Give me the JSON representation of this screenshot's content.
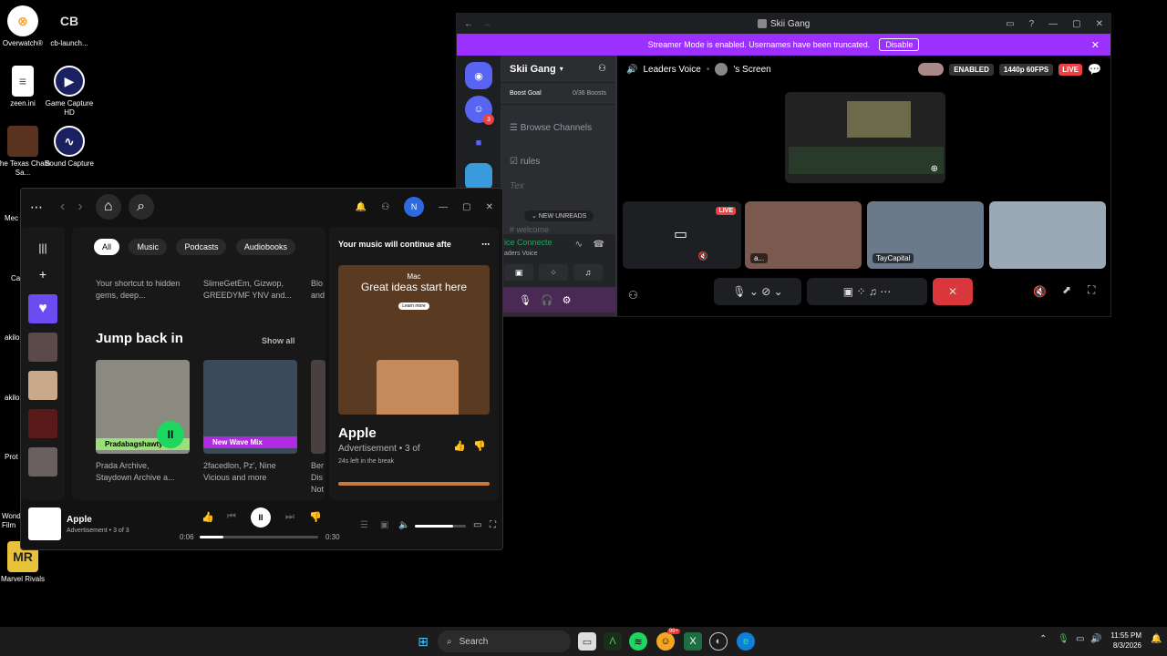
{
  "desktop": {
    "icons": [
      {
        "label": "Overwatch®",
        "glyph": "OW",
        "color": "#f99e1a"
      },
      {
        "label": "cb-launch...",
        "glyph": "CB",
        "color": "#ddd"
      },
      {
        "label": "zeen.ini",
        "glyph": "≡",
        "color": "#fff"
      },
      {
        "label": "Game Capture HD",
        "glyph": "▶",
        "color": "#2b3a8f"
      },
      {
        "label": "The Texas Chain Sa...",
        "glyph": "TX",
        "color": "#6b3a1f"
      },
      {
        "label": "Sound Capture",
        "glyph": "∿",
        "color": "#2b3a8f"
      },
      {
        "label": "Marvel Rivals",
        "glyph": "MR",
        "color": "#e8c23a"
      }
    ],
    "partial_labels": [
      "Mec",
      "Ca",
      "akilo",
      "akilo",
      "Prot",
      "Wond Film"
    ]
  },
  "discord": {
    "window_title": "Skii Gang",
    "banner_text": "Streamer Mode is enabled. Usernames have been truncated.",
    "banner_button": "Disable",
    "server_name": "Skii Gang",
    "boost_goal": "Boost Goal",
    "boost_count": "0/36 Boosts",
    "channels": [
      "Browse Channels",
      "rules"
    ],
    "new_unreads": "NEW UNREADS",
    "voice_connected": "ice Connecte",
    "voice_channel": "aders Voice",
    "header_channel": "Leaders Voice",
    "header_screen": "'s Screen",
    "enabled_badge": "ENABLED",
    "quality_badge": "1440p 60FPS",
    "live_badge": "LIVE",
    "tile_live": "LIVE",
    "tile_user_a": "a...",
    "tile_user_tay": "TayCapital",
    "mention_badge": "3",
    "truncated_text": "Tex",
    "truncated_welcome": "# welcome"
  },
  "spotify": {
    "avatar_letter": "N",
    "chips": [
      "All",
      "Music",
      "Podcasts",
      "Audiobooks"
    ],
    "top_cards": [
      {
        "text": "Your shortcut to hidden gems, deep..."
      },
      {
        "text": "SlimeGetEm, Gizwop, GREEDYMF YNV and..."
      },
      {
        "text": "Blo and"
      }
    ],
    "section_title": "Jump back in",
    "show_all": "Show all",
    "cards": [
      {
        "tag": "Pradabagshawty",
        "desc": "Prada Archive, Staydown Archive a..."
      },
      {
        "tag": "New Wave Mix",
        "desc": "2facedlon, Pz', Nine Vicious and more"
      },
      {
        "tag": "",
        "desc": "Ber Dis Not"
      }
    ],
    "panel_title": "Your music will continue afte",
    "ad_brand_small": "Mac",
    "ad_headline": "Great ideas start here",
    "ad_learn": "Learn more",
    "ad_title": "Apple",
    "ad_sub": "Advertisement • 3 of",
    "ad_time": "24s left in the break",
    "now_playing_title": "Apple",
    "now_playing_sub": "Advertisement • 3 of 3",
    "time_current": "0:06",
    "time_total": "0:30",
    "progress": 0.2,
    "volume": 0.75
  },
  "taskbar": {
    "search_placeholder": "Search",
    "time": "11:55 PM",
    "date": "8/3/2026",
    "badge": "99+"
  }
}
